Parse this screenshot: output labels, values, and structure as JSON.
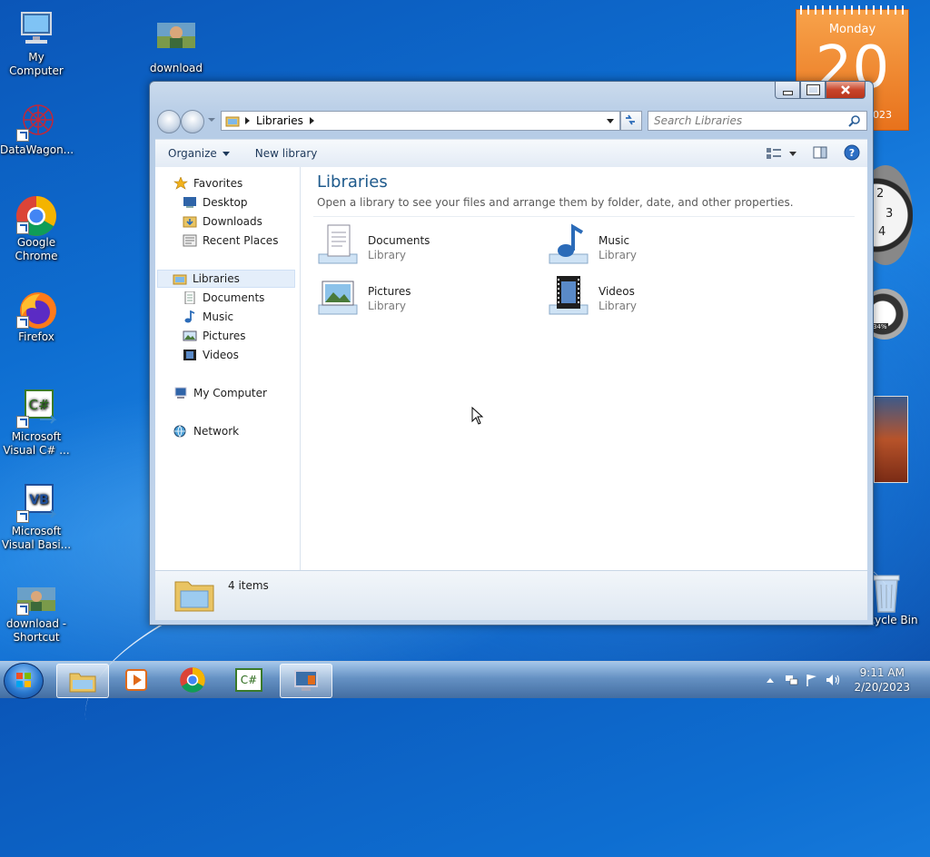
{
  "desktop": {
    "icons": [
      {
        "label": "My Computer"
      },
      {
        "label": "download"
      },
      {
        "label": "DataWagon..."
      },
      {
        "label": "Google Chrome"
      },
      {
        "label": "Firefox"
      },
      {
        "label": "Microsoft Visual C# ..."
      },
      {
        "label": "Microsoft Visual Basi..."
      },
      {
        "label": "download - Shortcut"
      },
      {
        "label": "Recycle Bin"
      }
    ],
    "calendar": {
      "day_name": "Monday",
      "day_number": "20",
      "year_fragment": "023"
    },
    "clock_numbers": [
      "2",
      "3",
      "4"
    ],
    "cpu_meter": "34%"
  },
  "window": {
    "address": {
      "crumb": "Libraries"
    },
    "search": {
      "placeholder": "Search Libraries"
    },
    "toolbar": {
      "organize": "Organize",
      "new_library": "New library"
    },
    "nav": {
      "favorites": "Favorites",
      "desktop": "Desktop",
      "downloads": "Downloads",
      "recent": "Recent Places",
      "libraries": "Libraries",
      "documents": "Documents",
      "music": "Music",
      "pictures": "Pictures",
      "videos": "Videos",
      "computer": "My Computer",
      "network": "Network"
    },
    "content": {
      "title": "Libraries",
      "description": "Open a library to see your files and arrange them by folder, date, and other properties.",
      "libraries": [
        {
          "name": "Documents",
          "type": "Library"
        },
        {
          "name": "Music",
          "type": "Library"
        },
        {
          "name": "Pictures",
          "type": "Library"
        },
        {
          "name": "Videos",
          "type": "Library"
        }
      ]
    },
    "status": {
      "items": "4 items"
    }
  },
  "taskbar": {
    "time": "9:11 AM",
    "date": "2/20/2023",
    "cs_label": "C#"
  }
}
